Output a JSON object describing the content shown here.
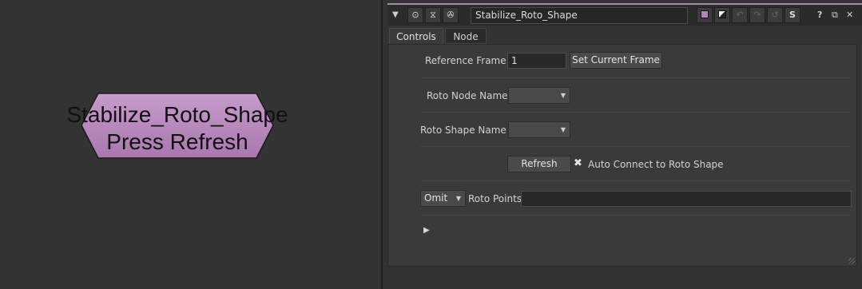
{
  "node_graph": {
    "node": {
      "line1": "Stabilize_Roto_Shape",
      "line2": "Press Refresh",
      "color": "#b484bb"
    }
  },
  "panel": {
    "title_name": "Stabilize_Roto_Shape",
    "accent_color": "#a889ad",
    "help_label": "?",
    "script_label": "S",
    "tabs": [
      {
        "label": "Controls",
        "active": true
      },
      {
        "label": "Node",
        "active": false
      }
    ],
    "reference_frame": {
      "label": "Reference Frame",
      "value": "1",
      "button": "Set Current Frame"
    },
    "roto_node_name": {
      "label": "Roto Node Name",
      "value": ""
    },
    "roto_shape_name": {
      "label": "Roto Shape Name",
      "value": ""
    },
    "refresh_button": "Refresh",
    "auto_connect": {
      "label": "Auto Connect to Roto Shape",
      "checked": true
    },
    "roto_points": {
      "mode": "Omit",
      "label": "Roto Points",
      "value": ""
    }
  }
}
